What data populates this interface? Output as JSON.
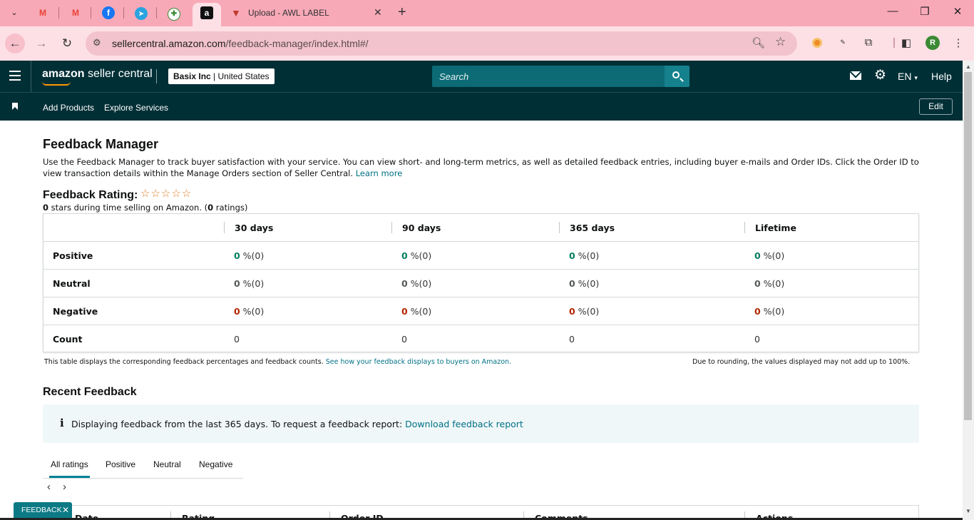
{
  "browser": {
    "pinned_tabs": [
      {
        "name": "gmail-1",
        "glyph": "M",
        "color": "#ea4335"
      },
      {
        "name": "gmail-2",
        "glyph": "M",
        "color": "#ea4335"
      },
      {
        "name": "facebook",
        "glyph": "f",
        "color": "#1877f2"
      },
      {
        "name": "telegram",
        "glyph": "➤",
        "color": "#2aa3df"
      },
      {
        "name": "extension",
        "glyph": "✚",
        "color": "#3a8a34"
      }
    ],
    "active_pinned_glyph": "a",
    "tab_title": "Upload - AWL LABEL",
    "url_host": "sellercentral.amazon.com",
    "url_path": "/feedback-manager/index.html#/",
    "profile_initial": "R"
  },
  "header": {
    "logo_bold": "amazon",
    "logo_rest": " seller central",
    "account_name": "Basix Inc",
    "account_region": "United States",
    "search_placeholder": "Search",
    "language": "EN",
    "help": "Help"
  },
  "nav": {
    "add_products": "Add Products",
    "explore_services": "Explore Services",
    "edit": "Edit"
  },
  "main": {
    "title": "Feedback Manager",
    "description": "Use the Feedback Manager to track buyer satisfaction with your service. You can view short- and long-term metrics, as well as detailed feedback entries, including buyer e-mails and Order IDs. Click the Order ID to view transaction details within the Manage Orders section of Seller Central.",
    "learn_more": "Learn more",
    "rating_label": "Feedback Rating:",
    "stars": "☆☆☆☆☆",
    "stars_count": "0",
    "stars_text": " stars during time selling on Amazon. (",
    "ratings_count": "0",
    "ratings_text": " ratings)"
  },
  "table": {
    "columns": [
      "30 days",
      "90 days",
      "365 days",
      "Lifetime"
    ],
    "rows": [
      {
        "label": "Positive",
        "cells": [
          {
            "v": "0",
            "pct": " %(0)"
          },
          {
            "v": "0",
            "pct": " %(0)"
          },
          {
            "v": "0",
            "pct": " %(0)"
          },
          {
            "v": "0",
            "pct": " %(0)"
          }
        ]
      },
      {
        "label": "Neutral",
        "cells": [
          {
            "v": "0",
            "pct": " %(0)"
          },
          {
            "v": "0",
            "pct": " %(0)"
          },
          {
            "v": "0",
            "pct": " %(0)"
          },
          {
            "v": "0",
            "pct": " %(0)"
          }
        ]
      },
      {
        "label": "Negative",
        "cells": [
          {
            "v": "0",
            "pct": " %(0)"
          },
          {
            "v": "0",
            "pct": " %(0)"
          },
          {
            "v": "0",
            "pct": " %(0)"
          },
          {
            "v": "0",
            "pct": " %(0)"
          }
        ]
      },
      {
        "label": "Count",
        "cells": [
          "0",
          "0",
          "0",
          "0"
        ]
      }
    ],
    "note_left": "This table displays the corresponding feedback percentages and feedback counts.",
    "note_left_link": "See how your feedback displays to buyers on Amazon.",
    "note_right": "Due to rounding, the values displayed may not add up to 100%."
  },
  "recent": {
    "title": "Recent Feedback",
    "info_icon": "i",
    "info_text": "Displaying feedback from the last 365 days. To request a feedback report:",
    "info_link": "Download feedback report",
    "tabs": [
      "All ratings",
      "Positive",
      "Neutral",
      "Negative"
    ],
    "grid_columns": [
      "Date",
      "Rating",
      "Order ID",
      "Comments",
      "Actions"
    ]
  },
  "feedback_chip": "FEEDBACK",
  "colors": {
    "positive": "#067d62",
    "neutral": "#565959",
    "negative": "#b12704",
    "header_bg": "#002f36",
    "link": "#007185"
  }
}
